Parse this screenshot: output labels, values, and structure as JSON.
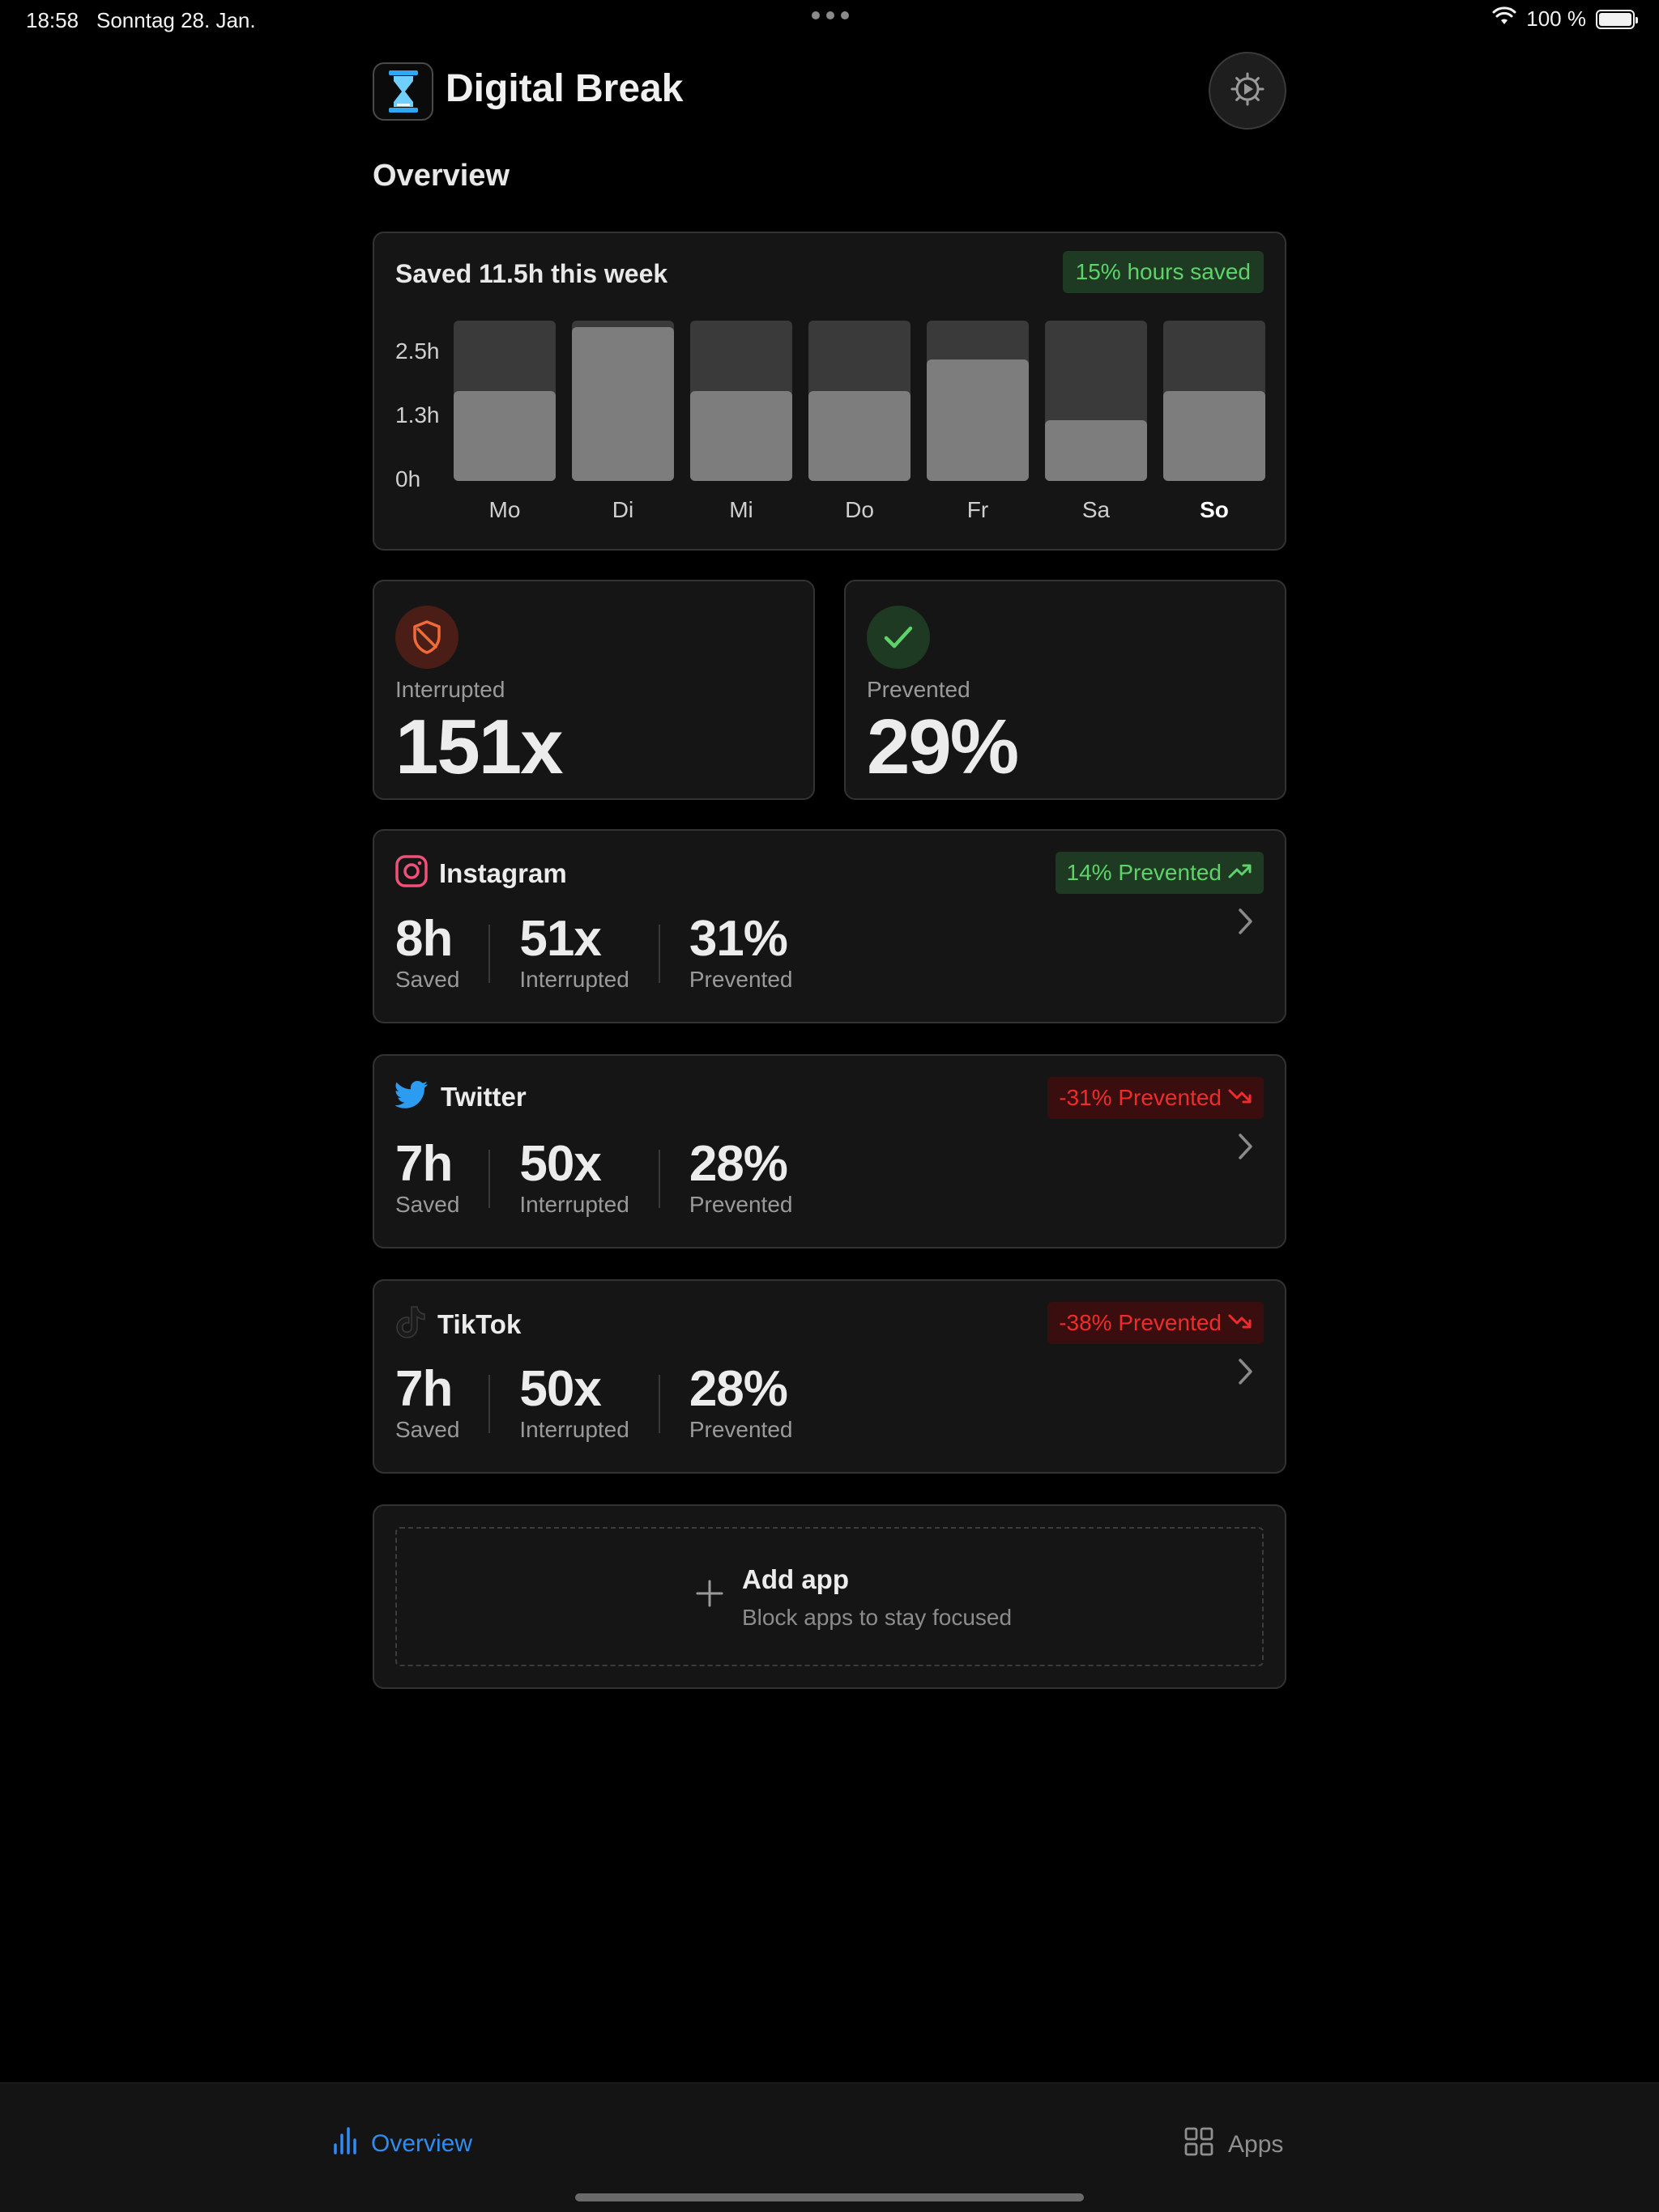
{
  "status_bar": {
    "time": "18:58",
    "date": "Sonntag 28. Jan.",
    "battery": "100 %"
  },
  "header": {
    "app_title": "Digital Break",
    "app_icon": "hourglass-icon",
    "settings_icon": "gear-icon"
  },
  "page": {
    "heading": "Overview"
  },
  "weekly": {
    "title": "Saved 11.5h this week",
    "badge": "15% hours saved",
    "y_ticks": [
      "2.5h",
      "1.3h",
      "0h"
    ],
    "active_day": "So"
  },
  "chart_data": {
    "type": "bar",
    "categories": [
      "Mo",
      "Di",
      "Mi",
      "Do",
      "Fr",
      "Sa",
      "So"
    ],
    "values": [
      1.4,
      2.4,
      1.4,
      1.4,
      1.9,
      0.95,
      1.4
    ],
    "ylim": [
      0,
      2.5
    ],
    "y_ticks": [
      "2.5h",
      "1.3h",
      "0h"
    ],
    "title": "Saved 11.5h this week",
    "xlabel": "",
    "ylabel": ""
  },
  "stats": {
    "interrupted": {
      "label": "Interrupted",
      "value": "151x",
      "icon": "shield-icon"
    },
    "prevented": {
      "label": "Prevented",
      "value": "29%",
      "icon": "check-icon"
    }
  },
  "apps": [
    {
      "name": "Instagram",
      "icon": "instagram-icon",
      "badge": "14% Prevented",
      "trend": "up",
      "saved": "8h",
      "saved_label": "Saved",
      "interrupted": "51x",
      "interrupted_label": "Interrupted",
      "prevented": "31%",
      "prevented_label": "Prevented"
    },
    {
      "name": "Twitter",
      "icon": "twitter-icon",
      "badge": "-31% Prevented",
      "trend": "down",
      "saved": "7h",
      "saved_label": "Saved",
      "interrupted": "50x",
      "interrupted_label": "Interrupted",
      "prevented": "28%",
      "prevented_label": "Prevented"
    },
    {
      "name": "TikTok",
      "icon": "tiktok-icon",
      "badge": "-38% Prevented",
      "trend": "down",
      "saved": "7h",
      "saved_label": "Saved",
      "interrupted": "50x",
      "interrupted_label": "Interrupted",
      "prevented": "28%",
      "prevented_label": "Prevented"
    }
  ],
  "add_app": {
    "title": "Add app",
    "subtitle": "Block apps to stay focused"
  },
  "tabbar": {
    "overview": "Overview",
    "apps": "Apps"
  },
  "colors": {
    "accent_blue": "#2f8cf0",
    "positive_green": "#5ed36a",
    "negative_red": "#ef2b2b",
    "card_bg": "#151515"
  }
}
